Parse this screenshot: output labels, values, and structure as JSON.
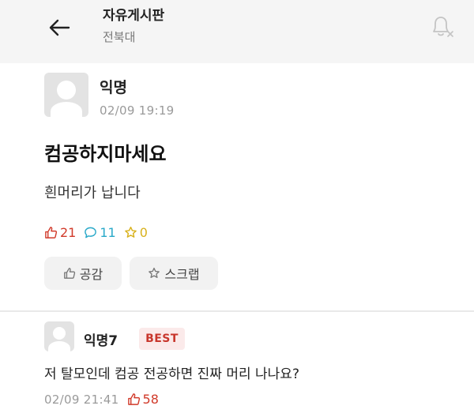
{
  "header": {
    "title": "자유게시판",
    "subtitle": "전북대",
    "back_icon": "arrow-left-icon",
    "notification_icon": "bell-off-icon"
  },
  "post": {
    "author": "익명",
    "date": "02/09 19:19",
    "title": "컴공하지마세요",
    "body": "흰머리가 납니다",
    "stats": {
      "likes": "21",
      "comments": "11",
      "scraps": "0"
    },
    "actions": {
      "like_label": "공감",
      "scrap_label": "스크랩"
    }
  },
  "comment": {
    "author": "익명7",
    "badge": "BEST",
    "text": "저 탈모인데 컴공 전공하면 진짜 머리 나나요?",
    "date": "02/09 21:41",
    "likes": "58"
  },
  "colors": {
    "like": "#d13a2a",
    "comment": "#2aa9c9",
    "scrap": "#d8b11c",
    "best_bg": "#fbeaea",
    "best_text": "#c8362c"
  }
}
